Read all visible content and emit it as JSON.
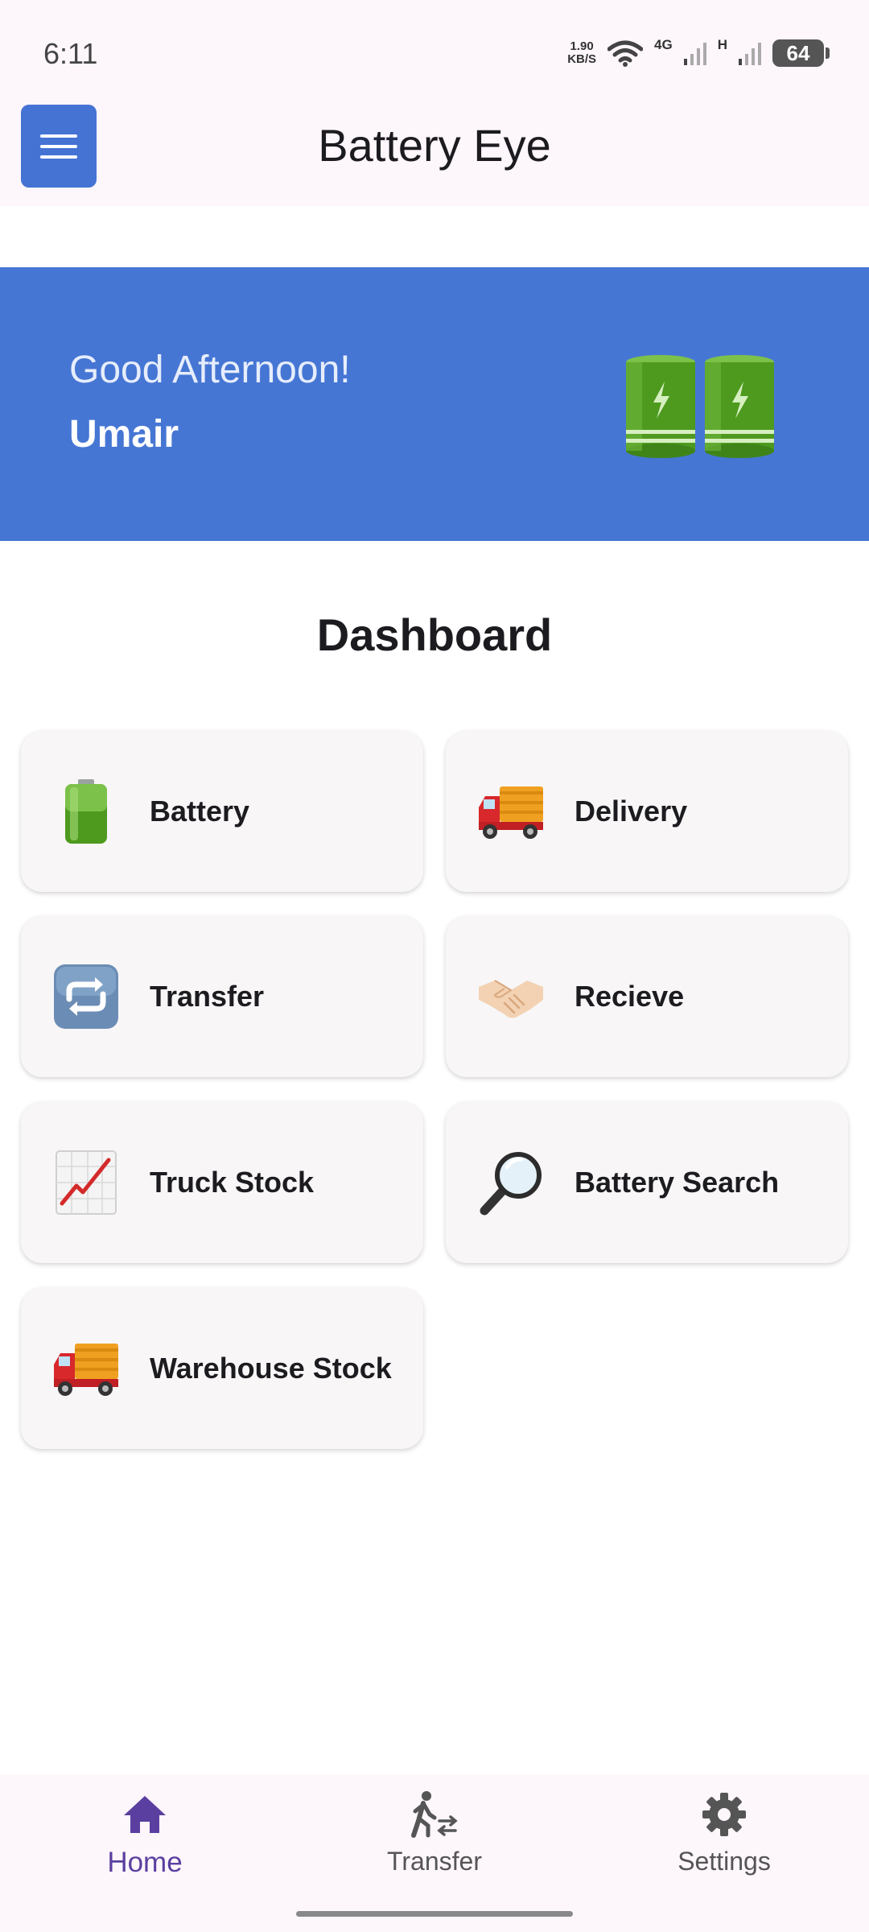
{
  "status_bar": {
    "time": "6:11",
    "net_speed_value": "1.90",
    "net_speed_unit": "KB/S",
    "network_1": "4G",
    "network_2": "H",
    "battery_level": "64"
  },
  "app_bar": {
    "title": "Battery Eye",
    "menu_icon": "hamburger-menu-icon"
  },
  "banner": {
    "greeting": "Good Afternoon!",
    "user_name": "Umair",
    "image_icon": "batteries-icon"
  },
  "dashboard": {
    "title": "Dashboard",
    "cards": [
      {
        "label": "Battery",
        "icon": "battery-icon"
      },
      {
        "label": "Delivery",
        "icon": "delivery-truck-icon"
      },
      {
        "label": "Transfer",
        "icon": "repeat-arrows-icon"
      },
      {
        "label": "Recieve",
        "icon": "handshake-icon"
      },
      {
        "label": "Truck Stock",
        "icon": "chart-increasing-icon"
      },
      {
        "label": "Battery Search",
        "icon": "magnifying-glass-icon"
      },
      {
        "label": "Warehouse Stock",
        "icon": "delivery-truck-icon"
      }
    ]
  },
  "bottom_nav": {
    "active": "Home",
    "items": [
      {
        "label": "Home",
        "icon": "home-icon"
      },
      {
        "label": "Transfer",
        "icon": "transfer-walk-icon"
      },
      {
        "label": "Settings",
        "icon": "gear-icon"
      }
    ]
  },
  "colors": {
    "primary_blue": "#4676d4",
    "nav_active": "#5b3fa0",
    "battery_green": "#4e9a1f"
  }
}
